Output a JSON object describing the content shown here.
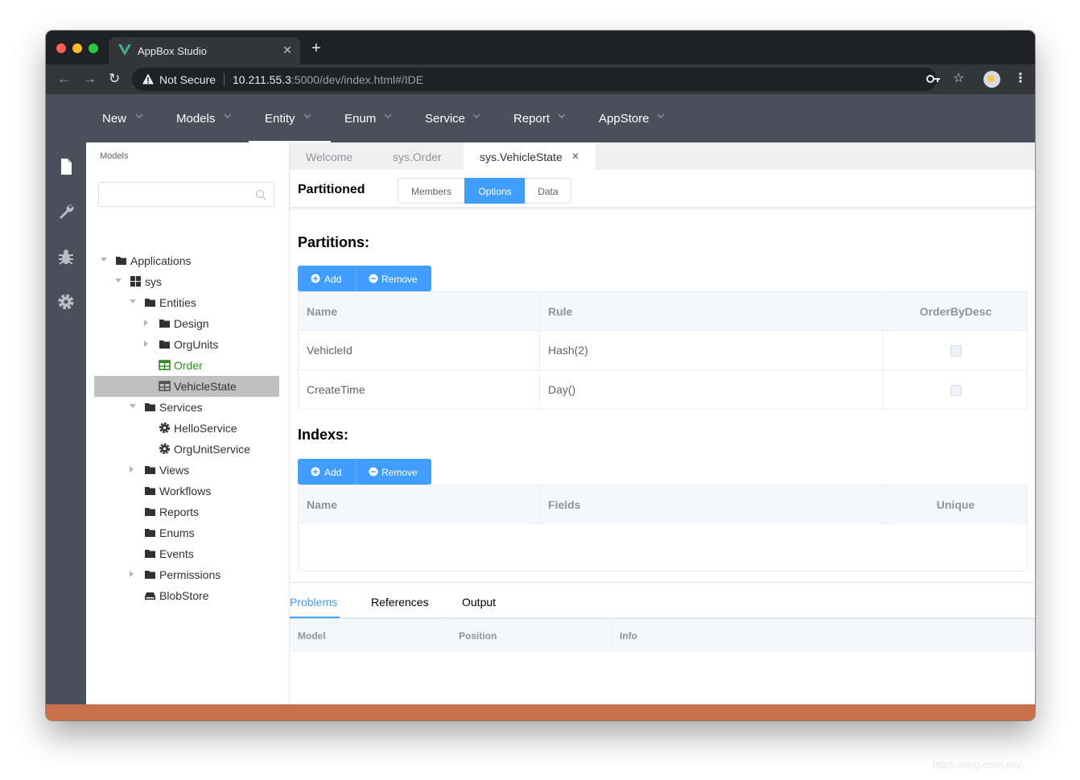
{
  "browser": {
    "tab_title": "AppBox Studio",
    "new_tab_label": "+",
    "close_label": "✕",
    "security_label": "Not Secure",
    "url_host": "10.211.55.3",
    "url_path": ":5000/dev/index.html#/IDE"
  },
  "topnav": {
    "items": [
      {
        "label": "New"
      },
      {
        "label": "Models"
      },
      {
        "label": "Entity"
      },
      {
        "label": "Enum"
      },
      {
        "label": "Service"
      },
      {
        "label": "Report"
      },
      {
        "label": "AppStore"
      }
    ],
    "active": "Entity"
  },
  "sidebar": {
    "title": "Models",
    "search_placeholder": "",
    "tree": [
      {
        "label": "Applications",
        "icon": "folder-icon",
        "caret": "down"
      },
      {
        "label": "sys",
        "icon": "app-grid-icon",
        "caret": "down"
      },
      {
        "label": "Entities",
        "icon": "folder-icon",
        "caret": "down"
      },
      {
        "label": "Design",
        "icon": "folder-icon",
        "caret": "right"
      },
      {
        "label": "OrgUnits",
        "icon": "folder-icon",
        "caret": "right"
      },
      {
        "label": "Order",
        "icon": "table-icon",
        "caret": "none",
        "color": "#2e8b1f"
      },
      {
        "label": "VehicleState",
        "icon": "table-icon",
        "caret": "none",
        "selected": true
      },
      {
        "label": "Services",
        "icon": "folder-icon",
        "caret": "down"
      },
      {
        "label": "HelloService",
        "icon": "gear-icon",
        "caret": "none"
      },
      {
        "label": "OrgUnitService",
        "icon": "gear-icon",
        "caret": "none"
      },
      {
        "label": "Views",
        "icon": "folder-icon",
        "caret": "right"
      },
      {
        "label": "Workflows",
        "icon": "folder-icon",
        "caret": "none"
      },
      {
        "label": "Reports",
        "icon": "folder-icon",
        "caret": "none"
      },
      {
        "label": "Enums",
        "icon": "folder-icon",
        "caret": "none"
      },
      {
        "label": "Events",
        "icon": "folder-icon",
        "caret": "none"
      },
      {
        "label": "Permissions",
        "icon": "folder-icon",
        "caret": "right"
      },
      {
        "label": "BlobStore",
        "icon": "drive-icon",
        "caret": "none"
      }
    ]
  },
  "editor": {
    "tabs": [
      {
        "label": "Welcome"
      },
      {
        "label": "sys.Order"
      },
      {
        "label": "sys.VehicleState",
        "active": true
      }
    ],
    "tab_close": "✕",
    "mode_label": "Partitioned",
    "segments": [
      {
        "label": "Members"
      },
      {
        "label": "Options",
        "active": true
      },
      {
        "label": "Data"
      }
    ],
    "partitions": {
      "title": "Partitions:",
      "add_label": "Add",
      "remove_label": "Remove",
      "columns": [
        "Name",
        "Rule",
        "OrderByDesc"
      ],
      "rows": [
        {
          "name": "VehicleId",
          "rule": "Hash(2)",
          "order_by_desc": false
        },
        {
          "name": "CreateTime",
          "rule": "Day()",
          "order_by_desc": false
        }
      ]
    },
    "indexes": {
      "title": "Indexs:",
      "add_label": "Add",
      "remove_label": "Remove",
      "columns": [
        "Name",
        "Fields",
        "Unique"
      ],
      "rows": []
    }
  },
  "bottom_panel": {
    "tabs": [
      {
        "label": "Problems",
        "active": true
      },
      {
        "label": "References"
      },
      {
        "label": "Output"
      }
    ],
    "columns": [
      "Model",
      "Position",
      "Info"
    ]
  },
  "watermark": "https://blog.csdn.net/...",
  "colors": {
    "nav_bg": "#4a4f5c",
    "accent": "#409eff",
    "status_bar": "#c9704b",
    "order_green": "#2e8b1f"
  }
}
